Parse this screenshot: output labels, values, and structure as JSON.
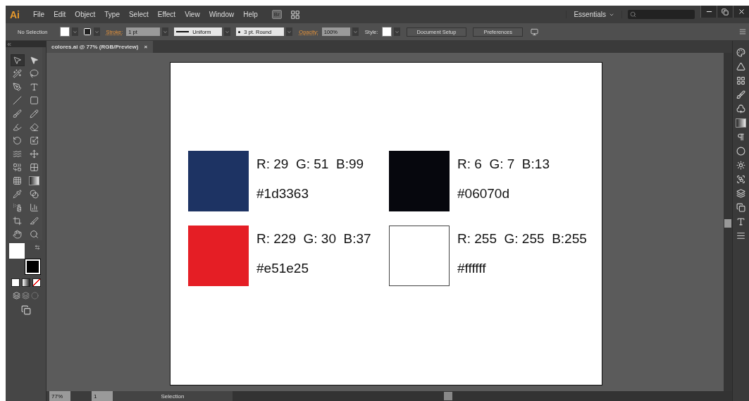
{
  "menu_bar": {
    "logo": "Ai",
    "items": [
      "File",
      "Edit",
      "Object",
      "Type",
      "Select",
      "Effect",
      "View",
      "Window",
      "Help"
    ],
    "bridge": "Br",
    "workspace": "Essentials"
  },
  "control_bar": {
    "selection": "No Selection",
    "stroke_label": "Stroke:",
    "stroke_weight": "1 pt",
    "profile": "Uniform",
    "brush": "3 pt. Round",
    "opacity_label": "Opacity:",
    "opacity": "100%",
    "style_label": "Style:",
    "buttons": [
      "Document Setup",
      "Preferences"
    ]
  },
  "document_tab": {
    "title": "colores.ai @ 77% (RGB/Preview)",
    "close": "×"
  },
  "tools": [
    {
      "kind": "selection",
      "selected": true
    },
    {
      "kind": "direct",
      "selected": false
    },
    {
      "kind": "wand",
      "selected": false
    },
    {
      "kind": "lasso",
      "selected": false
    },
    {
      "kind": "pen",
      "selected": false
    },
    {
      "kind": "type",
      "selected": false
    },
    {
      "kind": "line",
      "selected": false
    },
    {
      "kind": "rect",
      "selected": false
    },
    {
      "kind": "brush",
      "selected": false
    },
    {
      "kind": "pencil",
      "selected": false
    },
    {
      "kind": "blob",
      "selected": false
    },
    {
      "kind": "eraser",
      "selected": false
    },
    {
      "kind": "rotate",
      "selected": false
    },
    {
      "kind": "scale",
      "selected": false
    },
    {
      "kind": "warp",
      "selected": false
    },
    {
      "kind": "transform",
      "selected": false
    },
    {
      "kind": "shape",
      "selected": false
    },
    {
      "kind": "perspective",
      "selected": false
    },
    {
      "kind": "mesh",
      "selected": false
    },
    {
      "kind": "gradient",
      "selected": false
    },
    {
      "kind": "eyedropper",
      "selected": false
    },
    {
      "kind": "blend",
      "selected": false
    },
    {
      "kind": "spray",
      "selected": false
    },
    {
      "kind": "graph",
      "selected": false
    },
    {
      "kind": "artboard",
      "selected": false
    },
    {
      "kind": "slice",
      "selected": false
    },
    {
      "kind": "hand",
      "selected": false
    },
    {
      "kind": "zoom",
      "selected": false
    }
  ],
  "swatches": [
    {
      "color": "#1d3363",
      "rgb": "R: 29  G: 51  B:99",
      "hex": "#1d3363"
    },
    {
      "color": "#06070d",
      "rgb": "R: 6  G: 7  B:13",
      "hex": "#06070d"
    },
    {
      "color": "#e51e25",
      "rgb": "R: 229  G: 30  B:37",
      "hex": "#e51e25"
    },
    {
      "color": "#ffffff",
      "rgb": "R: 255  G: 255  B:255",
      "hex": "#ffffff"
    }
  ],
  "status_bar": {
    "zoom": "77%",
    "artboard": "1",
    "tool": "Selection"
  }
}
